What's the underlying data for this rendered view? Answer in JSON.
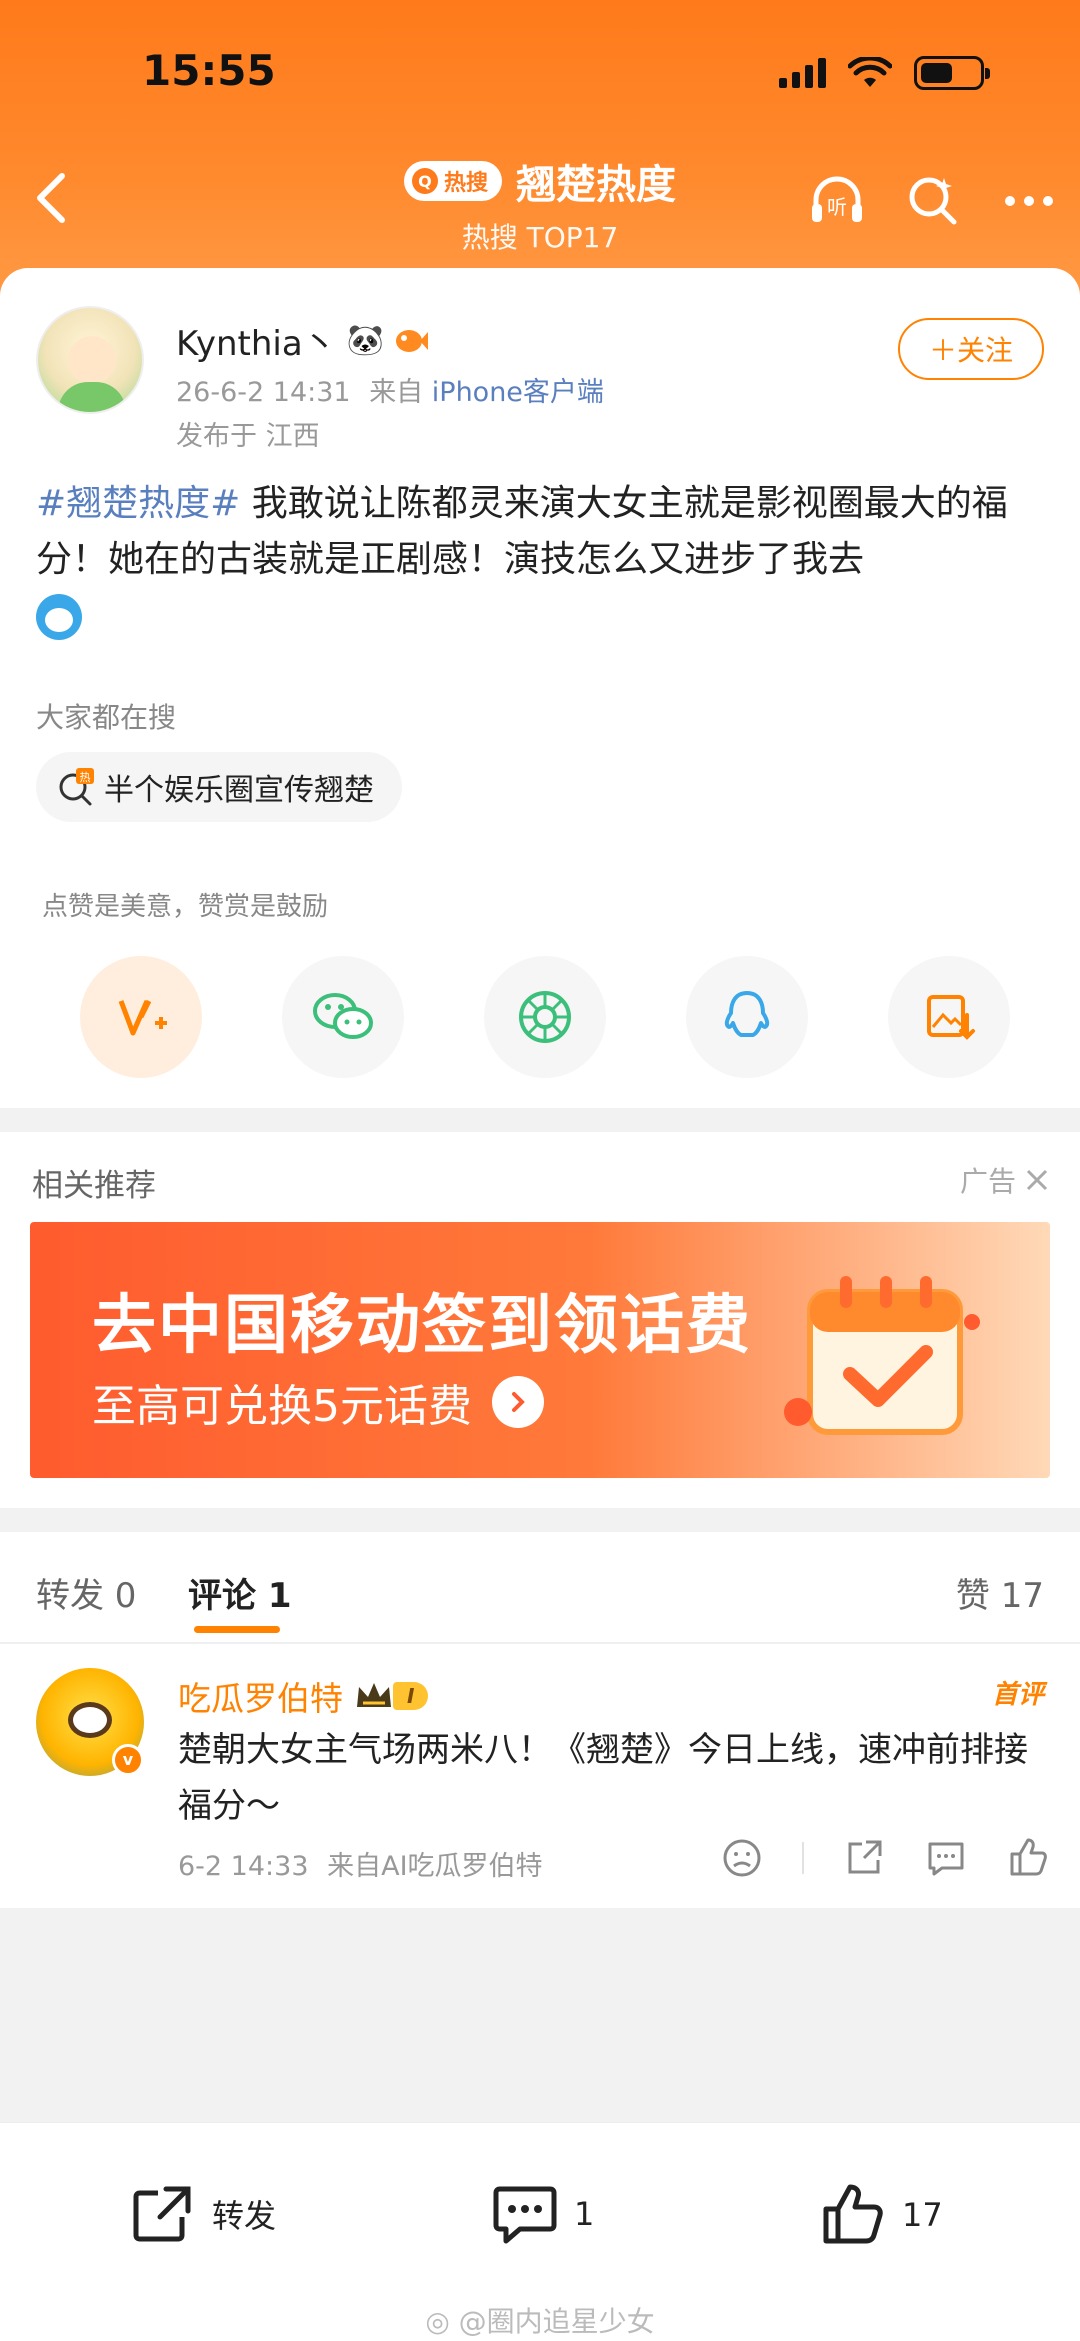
{
  "status_bar": {
    "time": "15:55"
  },
  "header": {
    "badge": "热搜",
    "title": "翘楚热度",
    "subtitle": "热搜 TOP17",
    "listen_label": "听"
  },
  "post": {
    "author": "Kynthia丶",
    "time": "26-6-2 14:31",
    "source_prefix": "来自",
    "source": "iPhone客户端",
    "location": "发布于 江西",
    "follow_label": "＋关注",
    "hashtag": "#翘楚热度#",
    "text": " 我敢说让陈都灵来演大女主就是影视圈最大的福分！她在的古装就是正剧感！演技怎么又进步了我去"
  },
  "search": {
    "label": "大家都在搜",
    "chip_badge": "热",
    "chip_text": "半个娱乐圈宣传翘楚"
  },
  "tip": {
    "text": "点赞是美意，赞赏是鼓励"
  },
  "share_buttons": [
    "reward-icon",
    "wechat-icon",
    "moments-icon",
    "qq-icon",
    "save-image-icon"
  ],
  "recommend": {
    "title": "相关推荐",
    "ad_label": "广告",
    "banner_title": "去中国移动签到领话费",
    "banner_sub": "至高可兑换5元话费"
  },
  "tabs": {
    "repost": "转发 0",
    "comments": "评论 1",
    "likes": "赞 17"
  },
  "comment": {
    "author": "吃瓜罗伯特",
    "level": "I",
    "first_badge": "首评",
    "text": "楚朝大女主气场两米八！《翘楚》今日上线，速冲前排接福分～",
    "time": "6-2 14:33",
    "source": "来自AI吃瓜罗伯特"
  },
  "bottom_bar": {
    "repost": "转发",
    "comments": "1",
    "likes": "17"
  },
  "watermark": "@圈内追星少女",
  "colors": {
    "accent": "#ff8200",
    "link": "#5a7fbf",
    "header": "#ff7a1a"
  }
}
